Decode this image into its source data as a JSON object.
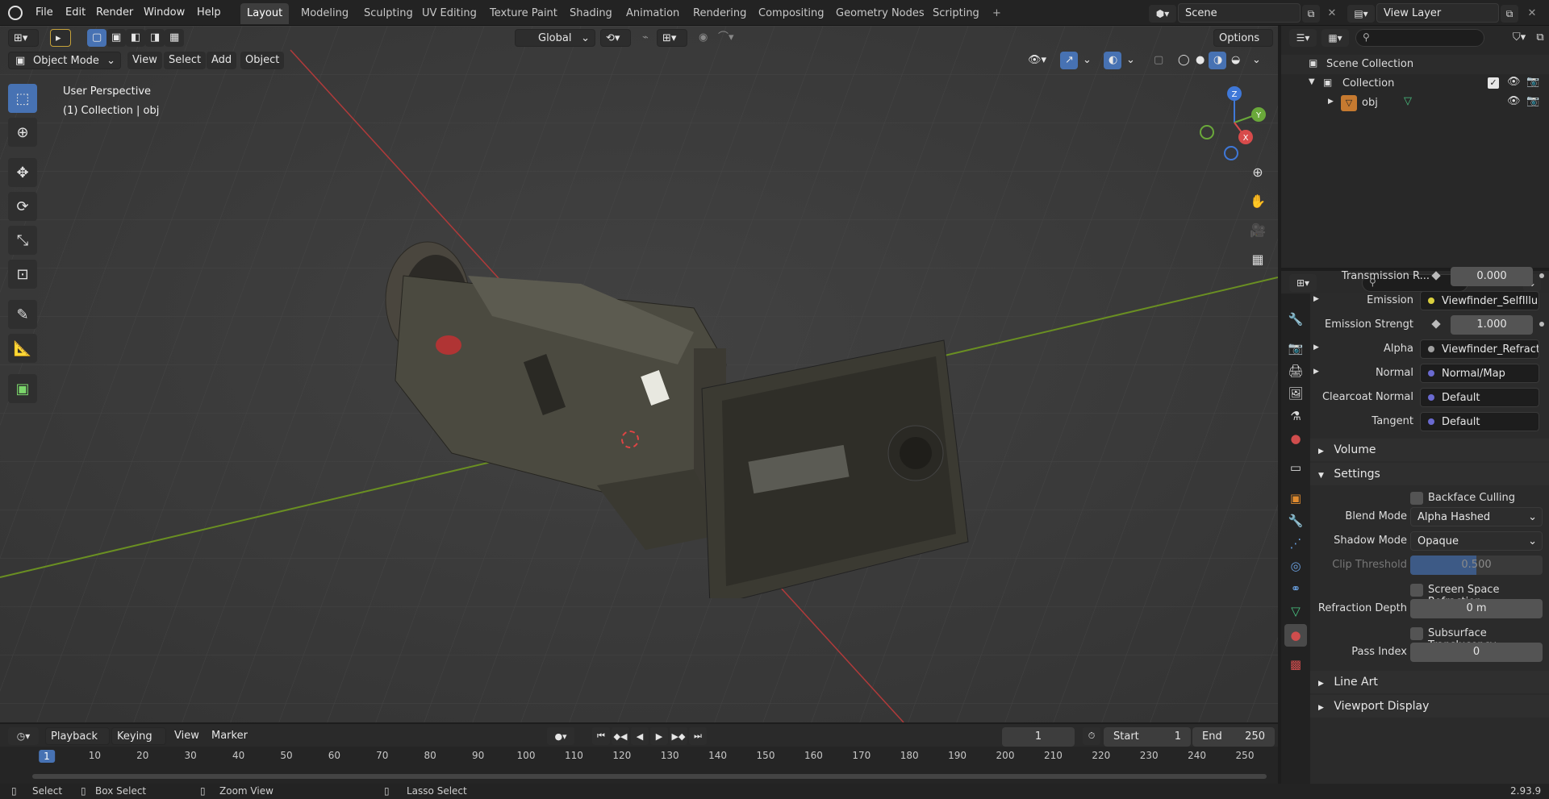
{
  "topbar": {
    "menus": [
      "File",
      "Edit",
      "Render",
      "Window",
      "Help"
    ],
    "workspaces": [
      "Layout",
      "Modeling",
      "Sculpting",
      "UV Editing",
      "Texture Paint",
      "Shading",
      "Animation",
      "Rendering",
      "Compositing",
      "Geometry Nodes",
      "Scripting"
    ],
    "add_tab": "+",
    "scene": "Scene",
    "view_layer": "View Layer"
  },
  "viewport": {
    "transform_orientation": "Global",
    "options_label": "Options",
    "mode": "Object Mode",
    "menus": [
      "View",
      "Select",
      "Add",
      "Object"
    ],
    "overlay_title": "User Perspective",
    "overlay_subtitle": "(1) Collection | obj",
    "gizmo": {
      "x": "X",
      "y": "Y",
      "z": "Z"
    }
  },
  "outliner": {
    "root": "Scene Collection",
    "collection": "Collection",
    "object": "obj"
  },
  "properties": {
    "rows": [
      {
        "label": "Transmission R...",
        "value": "0.000",
        "kind": "slider"
      },
      {
        "label": "Emission",
        "value": "Viewfinder_SelfIllum...",
        "kind": "link",
        "expand": true
      },
      {
        "label": "Emission Strengt",
        "value": "1.000",
        "kind": "slider"
      },
      {
        "label": "Alpha",
        "value": "Viewfinder_Refracti...",
        "kind": "link",
        "expand": true
      },
      {
        "label": "Normal",
        "value": "Normal/Map",
        "kind": "link",
        "expand": true
      },
      {
        "label": "Clearcoat Normal",
        "value": "Default",
        "kind": "link"
      },
      {
        "label": "Tangent",
        "value": "Default",
        "kind": "link"
      }
    ],
    "volume_label": "Volume",
    "settings_label": "Settings",
    "backface_culling": "Backface Culling",
    "blend_mode_label": "Blend Mode",
    "blend_mode_value": "Alpha Hashed",
    "shadow_mode_label": "Shadow Mode",
    "shadow_mode_value": "Opaque",
    "clip_threshold_label": "Clip Threshold",
    "clip_threshold_value": "0.500",
    "ssr_label": "Screen Space Refraction",
    "refraction_depth_label": "Refraction Depth",
    "refraction_depth_value": "0 m",
    "subsurface_label": "Subsurface Translucency",
    "pass_index_label": "Pass Index",
    "pass_index_value": "0",
    "line_art_label": "Line Art",
    "viewport_display_label": "Viewport Display"
  },
  "timeline": {
    "menus": [
      "Playback",
      "Keying",
      "View",
      "Marker"
    ],
    "current_frame": "1",
    "start_label": "Start",
    "start_value": "1",
    "end_label": "End",
    "end_value": "250",
    "ruler": [
      "1",
      "10",
      "20",
      "30",
      "40",
      "50",
      "60",
      "70",
      "80",
      "90",
      "100",
      "110",
      "120",
      "130",
      "140",
      "150",
      "160",
      "170",
      "180",
      "190",
      "200",
      "210",
      "220",
      "230",
      "240",
      "250"
    ]
  },
  "statusbar": {
    "select": "Select",
    "box_select": "Box Select",
    "zoom_view": "Zoom View",
    "lasso_select": "Lasso Select",
    "version": "2.93.9"
  }
}
